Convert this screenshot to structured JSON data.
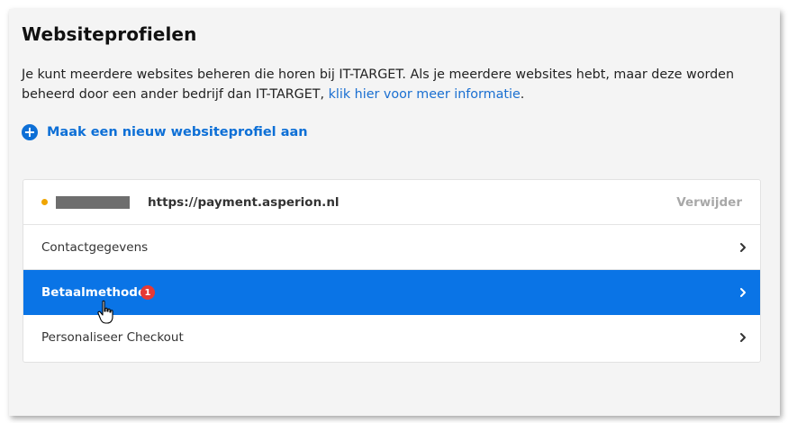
{
  "page": {
    "title": "Websiteprofielen",
    "description_text": "Je kunt meerdere websites beheren die horen bij IT-TARGET. Als je meerdere websites hebt, maar deze worden beheerd door een ander bedrijf dan IT-TARGET, ",
    "description_link": "klik hier voor meer informatie",
    "description_end": "."
  },
  "create": {
    "icon": "plus-circle-icon",
    "label": "Maak een nieuw websiteprofiel aan"
  },
  "profile": {
    "status_color": "#f0a500",
    "url": "https://payment.asperion.nl",
    "delete_label": "Verwijder"
  },
  "nav": {
    "items": [
      {
        "label": "Contactgegevens",
        "active": false
      },
      {
        "label": "Betaalmethodes",
        "active": true,
        "badge": "1"
      },
      {
        "label": "Personaliseer Checkout",
        "active": false
      }
    ]
  },
  "colors": {
    "accent": "#0a74e6",
    "badge": "#e53935"
  }
}
